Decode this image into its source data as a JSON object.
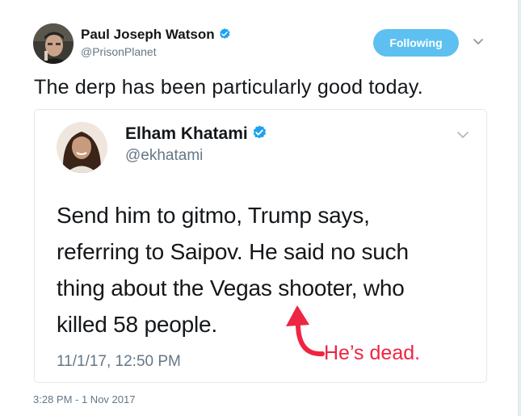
{
  "tweet": {
    "author_name": "Paul Joseph Watson",
    "author_handle": "@PrisonPlanet",
    "follow_button_label": "Following",
    "text": "The derp has been particularly good today.",
    "timestamp": "3:28 PM - 1 Nov 2017",
    "icons": {
      "verified": "verified-badge-icon",
      "more": "chevron-down-icon"
    }
  },
  "quoted_tweet": {
    "author_name": "Elham Khatami",
    "author_handle": "@ekhatami",
    "text_lines": [
      "Send him to gitmo, Trump says,",
      "referring to Saipov. He said no such",
      "thing about the Vegas shooter, who",
      "killed 58 people."
    ],
    "timestamp": "11/1/17, 12:50 PM",
    "annotation": "He’s dead."
  },
  "colors": {
    "accent": "#1da1f2",
    "follow_button": "#5dc0f1",
    "annotation": "#ee2543",
    "secondary_text": "#657786"
  }
}
